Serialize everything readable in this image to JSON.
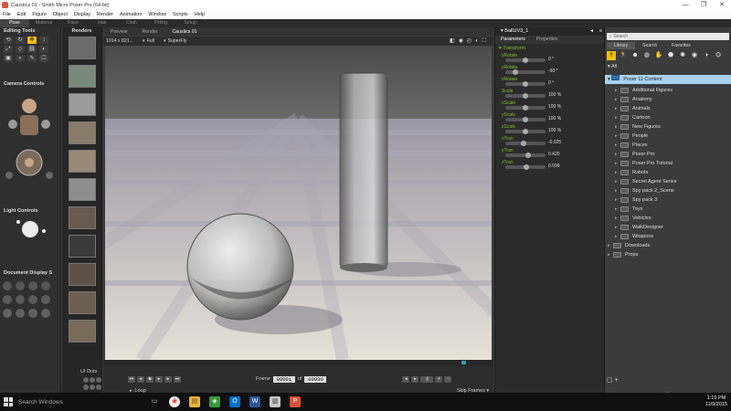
{
  "window": {
    "title": "Caustics 01 - Smith Micro Poser Pro (64-bit)",
    "controls": [
      "—",
      "❐",
      "✕"
    ]
  },
  "menu": [
    "File",
    "Edit",
    "Figure",
    "Object",
    "Display",
    "Render",
    "Animation",
    "Window",
    "Scripts",
    "Help"
  ],
  "room_tabs": [
    {
      "label": "Pose",
      "active": true
    },
    {
      "label": "Material",
      "active": false
    },
    {
      "label": "Face",
      "active": false
    },
    {
      "label": "Hair",
      "active": false
    },
    {
      "label": "Cloth",
      "active": false
    },
    {
      "label": "Fitting",
      "active": false
    },
    {
      "label": "Setup",
      "active": false
    }
  ],
  "left_panel": {
    "editing_tools_title": "Editing Tools",
    "camera_controls_title": "Camera Controls",
    "light_controls_title": "Light Controls",
    "document_display_title": "Document Display S",
    "ui_dots_title": "UI Dots"
  },
  "renders_panel": {
    "title": "Renders",
    "thumb_count": 12
  },
  "viewport_header": {
    "tabs": [
      "Preview",
      "Render",
      "Caustics 01"
    ],
    "active_tab": "Caustics 01",
    "resolution": "1014 x 821...",
    "size_mode": "Full",
    "renderer": "SuperFly"
  },
  "playback": {
    "frame_label": "Frame",
    "current_frame": "00001",
    "of_label": "of",
    "total_frames": "00030",
    "loop_label": "Loop",
    "skip_frames_label": "Skip Frames"
  },
  "parameters_panel": {
    "title": "BallUV3_1",
    "tabs": [
      "Parameters",
      "Properties"
    ],
    "group": "Transform",
    "rows": [
      {
        "label": "yRotate",
        "value": "0 °",
        "knob": 0.5
      },
      {
        "label": "xRotate",
        "value": "-90 °",
        "knob": 0.2
      },
      {
        "label": "zRotate",
        "value": "0 °",
        "knob": 0.5
      },
      {
        "label": "Scale",
        "value": "100 %",
        "knob": 0.5
      },
      {
        "label": "xScale",
        "value": "100 %",
        "knob": 0.5
      },
      {
        "label": "yScale",
        "value": "100 %",
        "knob": 0.5
      },
      {
        "label": "zScale",
        "value": "100 %",
        "knob": 0.5
      },
      {
        "label": "xTran",
        "value": "-0.025",
        "knob": 0.45
      },
      {
        "label": "yTran",
        "value": "0.420",
        "knob": 0.58
      },
      {
        "label": "zTran",
        "value": "0.099",
        "knob": 0.52
      }
    ]
  },
  "library_panel": {
    "search_placeholder": "Search",
    "tabs": [
      "Library",
      "Search",
      "Favorites"
    ],
    "filter_label": "All",
    "root": "Poser 11 Content",
    "folders": [
      "Additional Figures",
      "Anatomy",
      "Animals",
      "Cartoon",
      "New Figures",
      "People",
      "Places",
      "Poser Pro",
      "Poser Pro Tutorial",
      "Robots",
      "Secret Agent Series",
      "Spy pack 2_Scene",
      "Spy pack 3",
      "Toys",
      "Vehicles",
      "WalkDesigner",
      "Weapons"
    ],
    "top_level": [
      "Downloads",
      "Props"
    ]
  },
  "taskbar": {
    "search_text": "Search Windows",
    "time": "1:19 PM",
    "date": "11/9/2015"
  },
  "colors": {
    "param_label": "#7fbf2a",
    "selected_tool": "#f2c000",
    "library_selected": "#a8d1f0"
  }
}
